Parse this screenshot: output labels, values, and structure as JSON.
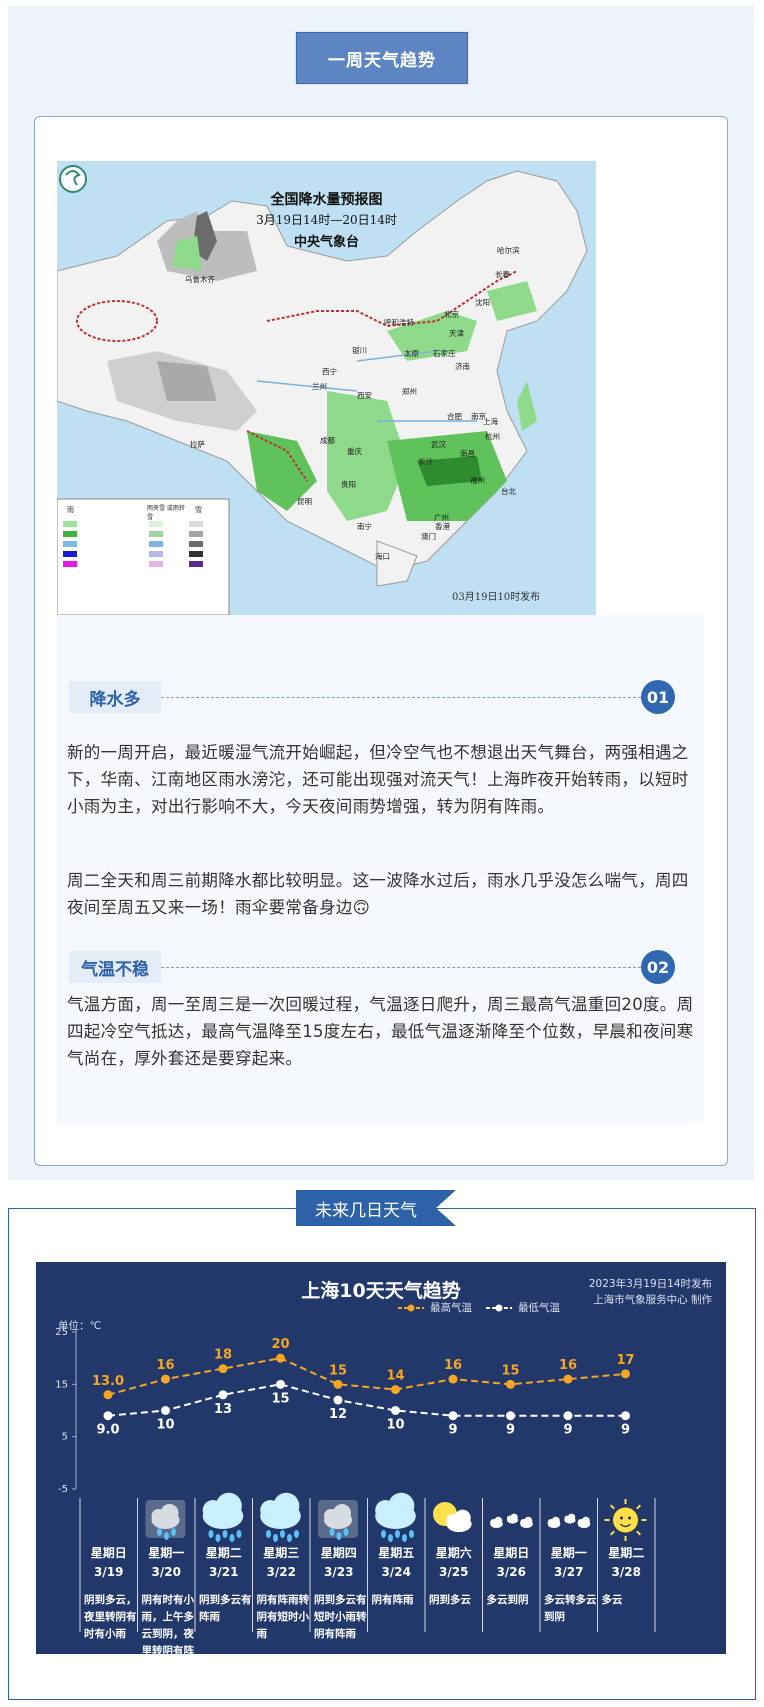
{
  "section1": {
    "header": "一周天气趋势",
    "map": {
      "title": "全国降水量预报图",
      "period": "3月19日14时—20日14时",
      "issuer": "中央气象台",
      "issued": "03月19日10时发布",
      "legend_rain": "雨",
      "legend_sleet": "雨夹雪 或雨转雪",
      "legend_snow": "雪",
      "cities": [
        "乌鲁木齐",
        "哈尔滨",
        "长春",
        "沈阳",
        "北京",
        "天津",
        "呼和浩特",
        "太原",
        "石家庄",
        "济南",
        "银川",
        "西宁",
        "兰州",
        "西安",
        "郑州",
        "合肥",
        "南京",
        "上海",
        "杭州",
        "武汉",
        "成都",
        "重庆",
        "长沙",
        "南昌",
        "拉萨",
        "贵阳",
        "昆明",
        "福州",
        "台北",
        "广州",
        "南宁",
        "香港",
        "澳门",
        "海口"
      ]
    },
    "topic1": {
      "number": "01",
      "label": "降水多"
    },
    "para1": "新的一周开启，最近暖湿气流开始崛起，但冷空气也不想退出天气舞台，两强相遇之下，华南、江南地区雨水滂沱，还可能出现强对流天气！上海昨夜开始转雨，以短时小雨为主，对出行影响不大，今天夜间雨势增强，转为阴有阵雨。",
    "para2": "周二全天和周三前期降水都比较明显。这一波降水过后，雨水几乎没怎么喘气，周四夜间至周五又来一场！雨伞要常备身边🙃",
    "topic2": {
      "number": "02",
      "label": "气温不稳"
    },
    "para3": "气温方面，周一至周三是一次回暖过程，气温逐日爬升，周三最高气温重回20度。周四起冷空气抵达，最高气温降至15度左右，最低气温逐渐降至个位数，早晨和夜间寒气尚在，厚外套还是要穿起来。"
  },
  "section2": {
    "header": "未来几日天气",
    "colors": {
      "high": "#f5a623",
      "low": "#ffffff",
      "bg": "#22386b"
    }
  },
  "chart_data": {
    "type": "line",
    "title": "上海10天天气趋势",
    "issued": "2023年3月19日14时发布",
    "producer": "上海市气象服务中心 制作",
    "unit_label": "单位：℃",
    "ylim": [
      -5,
      25
    ],
    "yticks": [
      "25",
      "15",
      "5",
      "-5"
    ],
    "x": [
      "星期日",
      "星期一",
      "星期二",
      "星期三",
      "星期四",
      "星期五",
      "星期六",
      "星期日",
      "星期一",
      "星期二"
    ],
    "dates": [
      "3/19",
      "3/20",
      "3/21",
      "3/22",
      "3/23",
      "3/24",
      "3/25",
      "3/26",
      "3/27",
      "3/28"
    ],
    "series": [
      {
        "name": "最高气温",
        "values": [
          13.0,
          16,
          18,
          20,
          15,
          14,
          16,
          15,
          16,
          17
        ],
        "labels": [
          "13.0",
          "16",
          "18",
          "20",
          "15",
          "14",
          "16",
          "15",
          "16",
          "17"
        ]
      },
      {
        "name": "最低气温",
        "values": [
          9.0,
          10,
          13,
          15,
          12,
          10,
          9,
          9,
          9,
          9
        ],
        "labels": [
          "9.0",
          "10",
          "13",
          "15",
          "12",
          "10",
          "9",
          "9",
          "9",
          "9"
        ]
      }
    ],
    "descriptions": [
      "阴到多云，夜里转阴有时有小雨",
      "阴有时有小雨，上午多云到阴，夜里转阴有阵雨",
      "阴到多云有阵雨",
      "阴有阵雨转阴有短时小雨",
      "阴到多云有短时小雨转阴有阵雨",
      "阴有阵雨",
      "阴到多云",
      "多云到阴",
      "多云转多云到阴",
      "多云"
    ],
    "icons": [
      "none",
      "cloud-rain-icon",
      "heavy-rain-icon",
      "heavy-rain-icon",
      "cloud-rain-icon",
      "heavy-rain-icon",
      "sun-cloud-icon",
      "cloudy-icon",
      "cloudy-icon",
      "sun-icon"
    ]
  }
}
